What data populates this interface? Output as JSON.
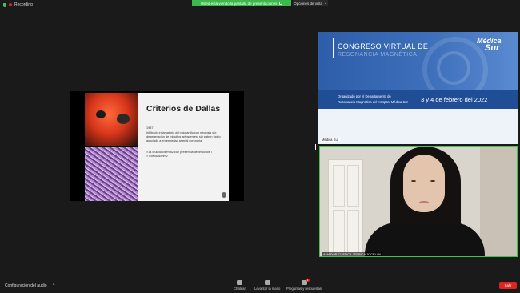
{
  "recording": {
    "label": "Recording"
  },
  "share_banner": {
    "text": "Usted está viendo la pantalla de presentaciones"
  },
  "view_options": {
    "label": "Opciones de vista"
  },
  "slide": {
    "title": "Criterios de Dallas",
    "year": "1987",
    "paragraph": "Infiltrado inflamatorio del miocardio con necrosis y/o degeneración de miocitos adyacentes, sin patrón típico asociado a enfermedad arterial coronaria",
    "bullets": [
      ">14 leucocitos/mm2 con presencia de linfocitos T",
      ">7 células/mm2"
    ]
  },
  "banner": {
    "congress_line1": "CONGRESO VIRTUAL DE",
    "congress_line2": "RESONANCIA MAGNÉTICA",
    "logo_line1": "Médica",
    "logo_line2": "Sur",
    "org_line1": "Organizado por el Departamento de",
    "org_line2": "Resonancia Magnética del Hospital Médica Sur",
    "date": "3 y 4 de febrero del 2022",
    "participant": "Médica Sur"
  },
  "camera": {
    "participant": "AMADOR CUENCA JESSICA JOCELYN"
  },
  "toolbar": {
    "audio_config": "Configuración del audio",
    "chat": "Chatear",
    "raise_hand": "Levantar la mano",
    "qa": "Preguntas y respuestas",
    "qa_badge": "1",
    "leave": "Salir"
  },
  "colors": {
    "share_banner": "#3db84c",
    "leave": "#e0241f",
    "banner_blue": "#2e5ea9",
    "active_border": "#3fc44f"
  }
}
